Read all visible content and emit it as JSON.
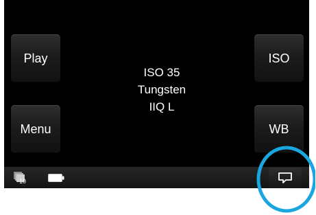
{
  "buttons": {
    "play": "Play",
    "menu": "Menu",
    "iso": "ISO",
    "wb": "WB"
  },
  "info": {
    "iso": "ISO 35",
    "white_balance": "Tungsten",
    "quality": "IIQ L"
  },
  "statusbar": {
    "stack_count": "10"
  },
  "icons": {
    "stack": "image-stack-icon",
    "battery": "battery-icon",
    "review": "speech-bubble-icon"
  },
  "colors": {
    "screen_background": "#000000",
    "text": "#ffffff",
    "highlight": "#1aa7e0"
  }
}
